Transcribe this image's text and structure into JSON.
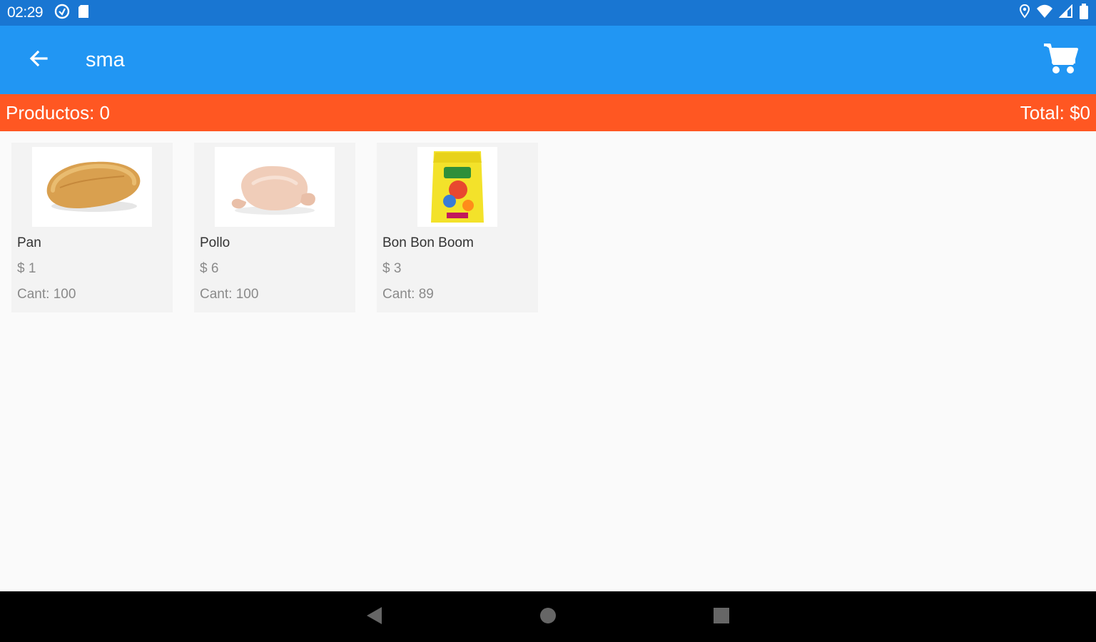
{
  "status_bar": {
    "time": "02:29",
    "left_icons": [
      "data-saver-icon",
      "sd-card-icon"
    ],
    "right_icons": [
      "location-icon",
      "wifi-icon",
      "cell-signal-icon",
      "battery-icon"
    ]
  },
  "app_bar": {
    "title": "sma",
    "back_icon": "arrow-back-icon",
    "cart_icon": "shopping-cart-icon"
  },
  "summary": {
    "products": "Productos: 0",
    "total": "Total: $0"
  },
  "products": [
    {
      "name": "Pan",
      "price": "$ 1",
      "qty": "Cant: 100",
      "image": "bread-image"
    },
    {
      "name": "Pollo",
      "price": "$ 6",
      "qty": "Cant: 100",
      "image": "chicken-image"
    },
    {
      "name": "Bon Bon Boom",
      "price": "$ 3",
      "qty": "Cant: 89",
      "image": "candy-bag-image"
    }
  ],
  "colors": {
    "status_bar": "#1976d2",
    "app_bar": "#2196f3",
    "summary_bar": "#ff5722",
    "background": "#fafafa",
    "card": "#f3f3f3"
  }
}
